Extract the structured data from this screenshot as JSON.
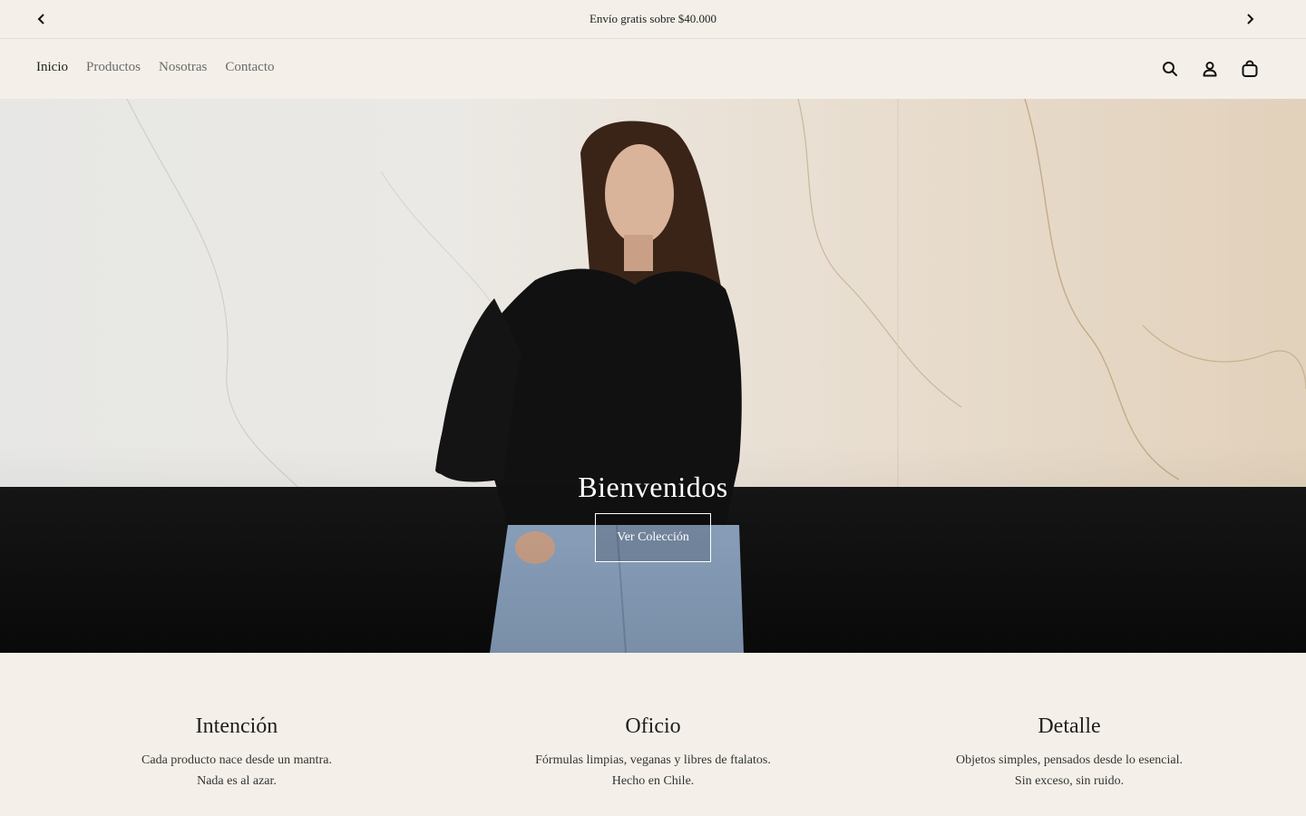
{
  "announcement": {
    "text": "Envío gratis sobre $40.000",
    "prev_icon": "chevron-left-icon",
    "next_icon": "chevron-right-icon"
  },
  "nav": {
    "items": [
      {
        "label": "Inicio",
        "active": true
      },
      {
        "label": "Productos",
        "active": false
      },
      {
        "label": "Nosotras",
        "active": false
      },
      {
        "label": "Contacto",
        "active": false
      }
    ]
  },
  "header_icons": [
    "search-icon",
    "account-icon",
    "cart-icon"
  ],
  "hero": {
    "title": "Bienvenidos",
    "button_label": "Ver Colección"
  },
  "values": [
    {
      "title": "Intención",
      "line1": "Cada producto nace desde un mantra.",
      "line2": "Nada es al azar."
    },
    {
      "title": "Oficio",
      "line1": "Fórmulas limpias, veganas y libres de ftalatos.",
      "line2": "Hecho en Chile."
    },
    {
      "title": "Detalle",
      "line1": "Objetos simples, pensados desde lo esencial.",
      "line2": "Sin exceso, sin ruido."
    }
  ],
  "colors": {
    "background": "#f4f0e9",
    "text": "#222222",
    "nav_inactive": "#6b6b6b"
  }
}
